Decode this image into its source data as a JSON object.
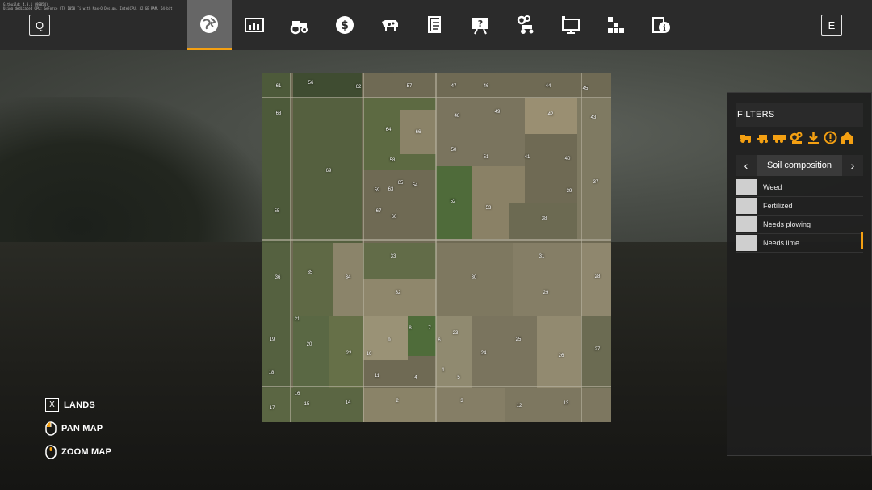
{
  "debug": {
    "line1": "Gitbuild: 4.3.1 (98854)",
    "line2": "Using dedicated GPU: GeForce GTX 1050 Ti with Max-Q Design, IntelCPU, 32 GB RAM, 64-bit"
  },
  "topbar": {
    "left_key": "Q",
    "right_key": "E",
    "tabs": [
      {
        "icon": "globe-icon",
        "active": true
      },
      {
        "icon": "chart-icon",
        "active": false
      },
      {
        "icon": "tractor-icon",
        "active": false
      },
      {
        "icon": "dollar-icon",
        "active": false
      },
      {
        "icon": "cow-icon",
        "active": false
      },
      {
        "icon": "contracts-icon",
        "active": false
      },
      {
        "icon": "help-board-icon",
        "active": false
      },
      {
        "icon": "gear-tractor-icon",
        "active": false
      },
      {
        "icon": "monitor-icon",
        "active": false
      },
      {
        "icon": "production-icon",
        "active": false
      },
      {
        "icon": "info-icon",
        "active": false
      }
    ]
  },
  "map": {
    "fields": [
      "61",
      "56",
      "62",
      "57",
      "47",
      "46",
      "44",
      "45",
      "68",
      "48",
      "49",
      "42",
      "43",
      "64",
      "66",
      "50",
      "51",
      "41",
      "40",
      "58",
      "69",
      "65",
      "54",
      "59",
      "63",
      "39",
      "37",
      "52",
      "53",
      "55",
      "67",
      "60",
      "38",
      "33",
      "31",
      "36",
      "35",
      "34",
      "30",
      "28",
      "32",
      "29",
      "21",
      "8",
      "7",
      "23",
      "19",
      "20",
      "22",
      "10",
      "9",
      "6",
      "25",
      "24",
      "26",
      "27",
      "18",
      "11",
      "4",
      "1",
      "5",
      "16",
      "14",
      "2",
      "3",
      "12",
      "13",
      "15",
      "17"
    ]
  },
  "legend": {
    "lands_key": "X",
    "lands": "LANDS",
    "pan": "PAN MAP",
    "zoom": "ZOOM MAP"
  },
  "filters": {
    "title": "FILTERS",
    "icons": [
      "tractor-filter-icon",
      "harvester-filter-icon",
      "trailer-filter-icon",
      "tools-filter-icon",
      "download-filter-icon",
      "warning-filter-icon",
      "farmhouse-filter-icon"
    ],
    "selector": "Soil composition",
    "items": [
      "Weed",
      "Fertilized",
      "Needs plowing",
      "Needs lime"
    ]
  },
  "colors": {
    "accent": "#f4a012",
    "swatch": "#cfcfcf"
  }
}
